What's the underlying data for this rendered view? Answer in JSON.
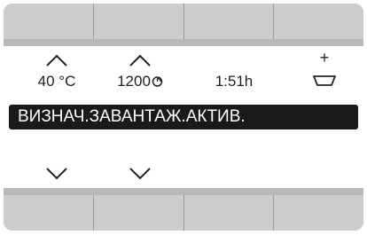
{
  "display": {
    "temperature": "40 °C",
    "spin_speed": "1200",
    "spin_icon": "spin-icon",
    "duration": "1:51h",
    "load_plus": "+",
    "load_icon": "tray-icon",
    "status": "ВИЗНАЧ.ЗАВАНТАЖ.АКТИВ."
  },
  "softkeys_top_count": 4,
  "softkeys_bottom_count": 4,
  "colors": {
    "softkey": "#cccccc",
    "band": "#b8b8b8",
    "status_bg": "#1a1a1a",
    "status_text": "#ffffff"
  }
}
